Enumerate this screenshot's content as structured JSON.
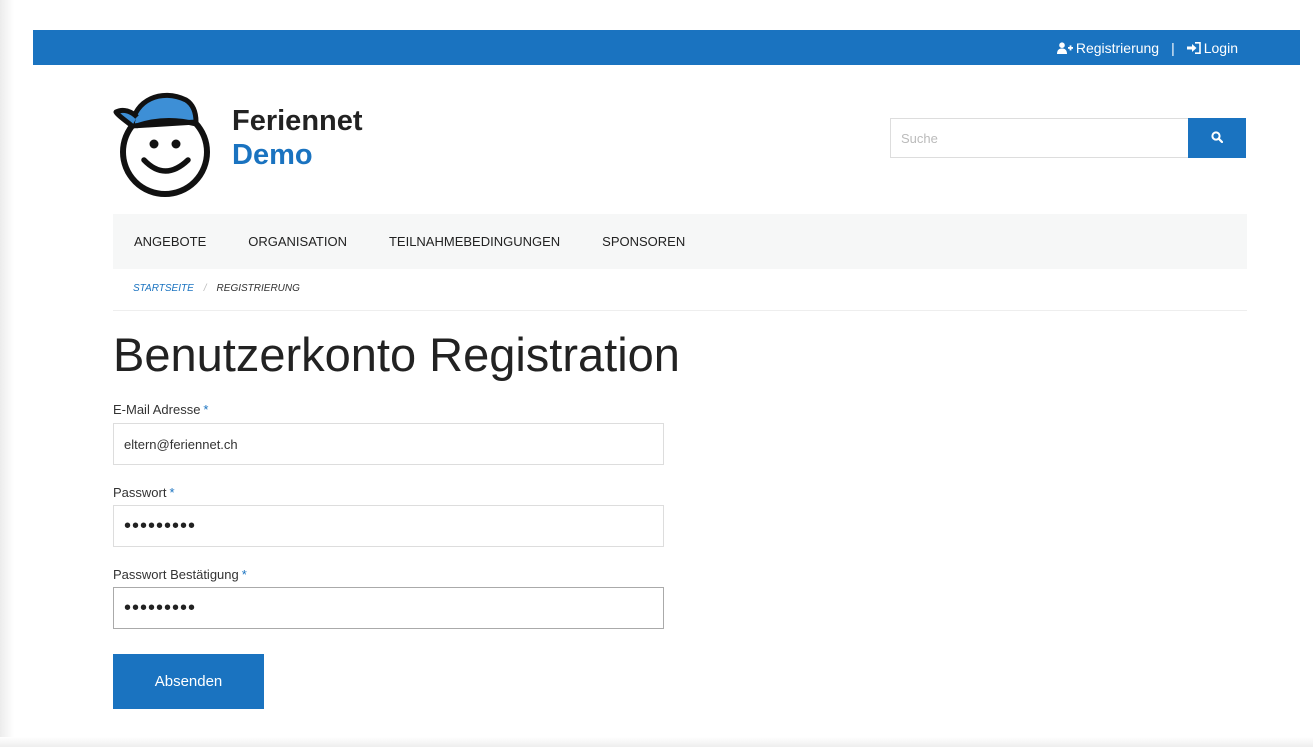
{
  "topbar": {
    "register_label": "Registrierung",
    "separator": "|",
    "login_label": "Login"
  },
  "brand": {
    "line1": "Feriennet",
    "line2": "Demo"
  },
  "search": {
    "placeholder": "Suche",
    "icon": "search-icon"
  },
  "nav": {
    "items": [
      "ANGEBOTE",
      "ORGANISATION",
      "TEILNAHMEBEDINGUNGEN",
      "SPONSOREN"
    ]
  },
  "breadcrumb": {
    "home": "STARTSEITE",
    "separator": "/",
    "current": "REGISTRIERUNG"
  },
  "page": {
    "title": "Benutzerkonto Registration"
  },
  "form": {
    "email_label": "E-Mail Adresse",
    "email_value": "eltern@feriennet.ch",
    "password_label": "Passwort",
    "password_value": "•••••••••",
    "password_confirm_label": "Passwort Bestätigung",
    "password_confirm_value": "•••••••••",
    "required_marker": "*",
    "submit_label": "Absenden"
  },
  "colors": {
    "accent": "#1a73c0",
    "nav_background": "#f6f7f7",
    "text": "#222222"
  }
}
